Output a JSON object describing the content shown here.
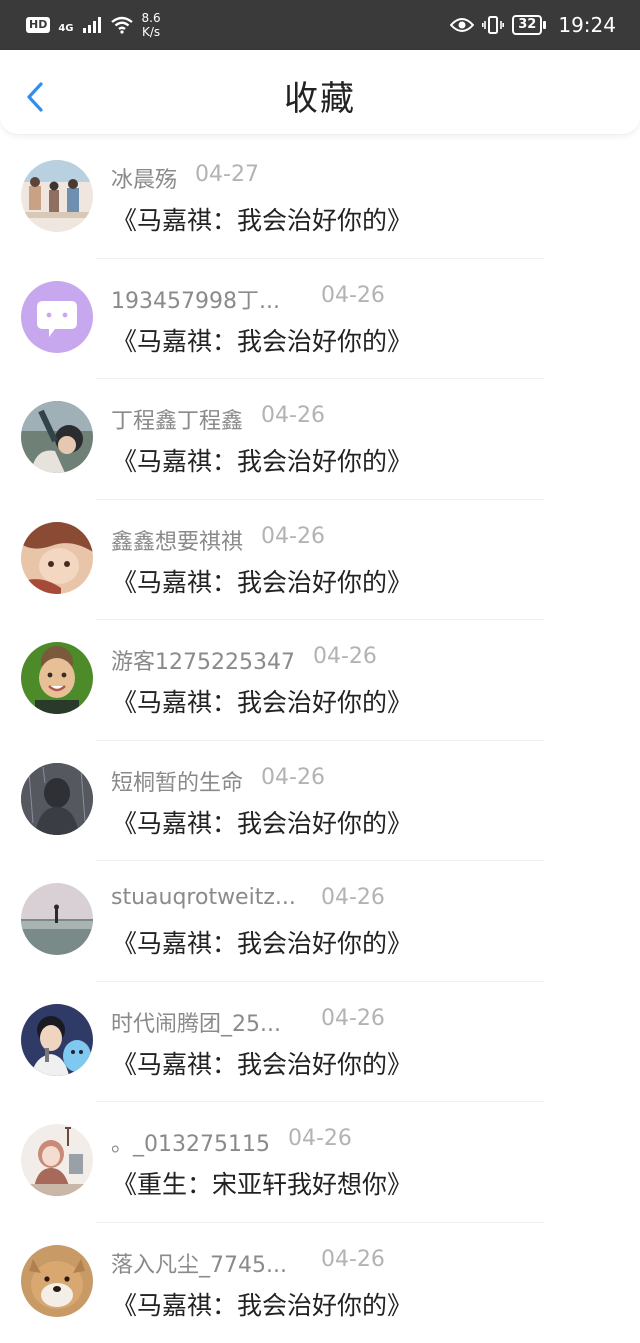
{
  "status_bar": {
    "hd": "HD",
    "network": "4G",
    "speed_value": "8.6",
    "speed_unit": "K/s",
    "battery": "32",
    "time": "19:24"
  },
  "header": {
    "title": "收藏"
  },
  "favorites": [
    {
      "name": "冰晨殇",
      "date": "04-27",
      "title": "《马嘉祺：我会治好你的》",
      "avatar": "classroom-illustration-avatar",
      "colors": [
        "#c9a184",
        "#6e8fb0"
      ]
    },
    {
      "name": "193457998丁...",
      "date": "04-26",
      "title": "《马嘉祺：我会治好你的》",
      "avatar": "purple-chat-icon-avatar",
      "colors": [
        "#c7a8ef",
        "#ffffff"
      ]
    },
    {
      "name": "丁程鑫丁程鑫",
      "date": "04-26",
      "title": "《马嘉祺：我会治好你的》",
      "avatar": "boy-photo-avatar",
      "colors": [
        "#34434a",
        "#9fb0b6"
      ]
    },
    {
      "name": "鑫鑫想要祺祺",
      "date": "04-26",
      "title": "《马嘉祺：我会治好你的》",
      "avatar": "anime-boy-avatar",
      "colors": [
        "#8a4a34",
        "#e8c4a8"
      ]
    },
    {
      "name": "游客1275225347",
      "date": "04-26",
      "title": "《马嘉祺：我会治好你的》",
      "avatar": "child-photo-avatar",
      "colors": [
        "#4c8a2a",
        "#e8c098"
      ]
    },
    {
      "name": "短桐暂的生命",
      "date": "04-26",
      "title": "《马嘉祺：我会治好你的》",
      "avatar": "dark-figure-avatar",
      "colors": [
        "#3a3d44",
        "#6a6d78"
      ]
    },
    {
      "name": "stuauqrotweitz...",
      "date": "04-26",
      "title": "《马嘉祺：我会治好你的》",
      "avatar": "seaside-figure-avatar",
      "colors": [
        "#c9c0c8",
        "#4a6a68"
      ]
    },
    {
      "name": "时代闹腾团_25...",
      "date": "04-26",
      "title": "《马嘉祺：我会治好你的》",
      "avatar": "singer-photo-avatar",
      "colors": [
        "#2f3a66",
        "#7fc8ef"
      ]
    },
    {
      "name": "。_013275115",
      "date": "04-26",
      "title": "《重生：宋亚轩我好想你》",
      "avatar": "girl-illustration-avatar",
      "colors": [
        "#f2ede8",
        "#a8685a"
      ]
    },
    {
      "name": "落入凡尘_7745...",
      "date": "04-26",
      "title": "《马嘉祺：我会治好你的》",
      "avatar": "dog-photo-avatar",
      "colors": [
        "#c89a66",
        "#f4efe6"
      ]
    }
  ],
  "colors": {
    "status_bar_bg": "#3a3a3a",
    "back_arrow": "#2f8ef0"
  }
}
